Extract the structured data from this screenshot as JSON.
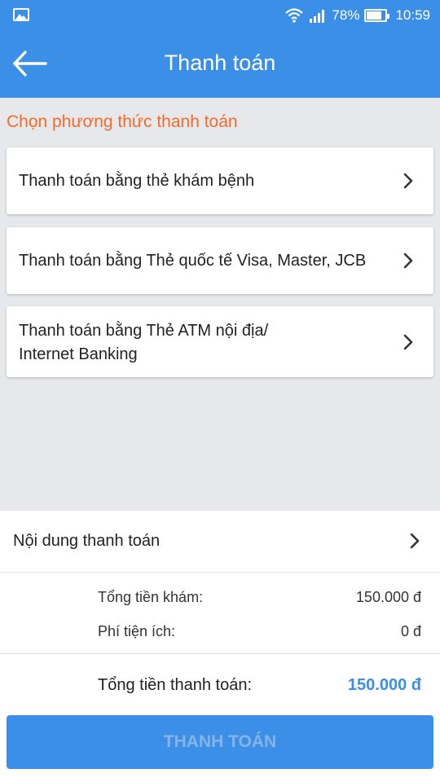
{
  "status_bar": {
    "battery_percent": "78%",
    "battery_level": 0.78,
    "time": "10:59",
    "icons": [
      "image-icon",
      "wifi-icon",
      "signal-icon",
      "battery-icon"
    ]
  },
  "app_bar": {
    "title": "Thanh toán",
    "back_icon": "arrow-left-icon"
  },
  "payment_methods": {
    "heading": "Chọn phương thức thanh toán",
    "items": [
      {
        "label": "Thanh toán bằng thẻ khám bệnh"
      },
      {
        "label": "Thanh toán bằng Thẻ quốc tế Visa, Master, JCB"
      },
      {
        "label_line1": "Thanh toán bằng Thẻ ATM nội địa/",
        "label_line2": "Internet Banking"
      }
    ]
  },
  "summary": {
    "content_label": "Nội dung thanh toán",
    "exam_total_label": "Tổng tiền khám:",
    "exam_total_value": "150.000 đ",
    "fee_label": "Phí tiện ích:",
    "fee_value": "0 đ",
    "grand_total_label": "Tổng tiền thanh toán:",
    "grand_total_value": "150.000 đ"
  },
  "pay_button": {
    "label": "THANH TOÁN"
  },
  "colors": {
    "primary": "#3b8fe6",
    "heading_orange": "#f26b2a",
    "background": "#e6e8ec"
  }
}
